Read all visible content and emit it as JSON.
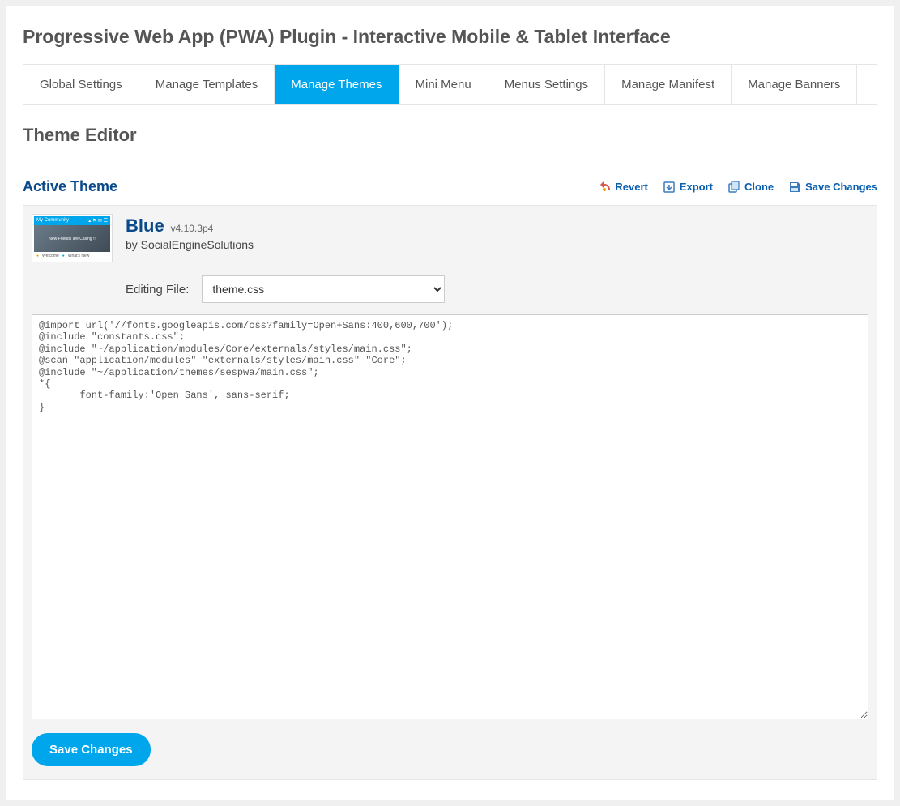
{
  "page": {
    "title": "Progressive Web App (PWA) Plugin - Interactive Mobile & Tablet Interface",
    "section_title": "Theme Editor"
  },
  "tabs": [
    {
      "label": "Global Settings",
      "active": false
    },
    {
      "label": "Manage Templates",
      "active": false
    },
    {
      "label": "Manage Themes",
      "active": true
    },
    {
      "label": "Mini Menu",
      "active": false
    },
    {
      "label": "Menus Settings",
      "active": false
    },
    {
      "label": "Manage Manifest",
      "active": false
    },
    {
      "label": "Manage Banners",
      "active": false
    }
  ],
  "active_theme": {
    "label": "Active Theme",
    "actions": {
      "revert": "Revert",
      "export": "Export",
      "clone": "Clone",
      "save": "Save Changes"
    }
  },
  "theme": {
    "name": "Blue",
    "version": "v4.10.3p4",
    "by": "by SocialEngineSolutions",
    "thumb": {
      "top_left": "My Community",
      "mid": "New Friends are Calling !!",
      "bot1": "Welcome",
      "bot2": "What's New"
    }
  },
  "editor": {
    "editing_label": "Editing File:",
    "file_options": [
      "theme.css"
    ],
    "file_selected": "theme.css",
    "code": "@import url('//fonts.googleapis.com/css?family=Open+Sans:400,600,700');\n@include \"constants.css\";\n@include \"~/application/modules/Core/externals/styles/main.css\";\n@scan \"application/modules\" \"externals/styles/main.css\" \"Core\";\n@include \"~/application/themes/sespwa/main.css\";\n*{\n       font-family:'Open Sans', sans-serif;\n}",
    "save_button": "Save Changes"
  }
}
